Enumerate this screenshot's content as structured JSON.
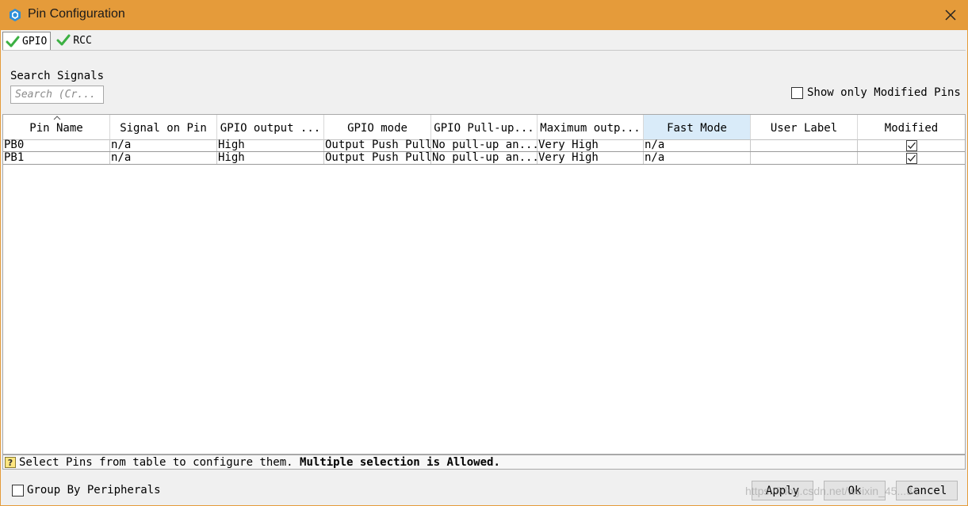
{
  "window": {
    "title": "Pin Configuration"
  },
  "tabs": [
    {
      "label": "GPIO",
      "active": true
    },
    {
      "label": "RCC",
      "active": false
    }
  ],
  "search": {
    "label": "Search Signals",
    "placeholder": "Search (Cr..."
  },
  "show_modified": {
    "label": "Show only Modified Pins",
    "checked": false
  },
  "table": {
    "columns": [
      "Pin Name",
      "Signal on Pin",
      "GPIO output ...",
      "GPIO mode",
      "GPIO Pull-up...",
      "Maximum outp...",
      "Fast Mode",
      "User Label",
      "Modified"
    ],
    "sorted_column": "Pin Name",
    "highlighted_column": "Fast Mode",
    "rows": [
      {
        "pin": "PB0",
        "signal": "n/a",
        "output": "High",
        "mode": "Output Push Pull",
        "pull": "No pull-up an...",
        "speed": "Very High",
        "fast": "n/a",
        "label": "",
        "modified": true
      },
      {
        "pin": "PB1",
        "signal": "n/a",
        "output": "High",
        "mode": "Output Push Pull",
        "pull": "No pull-up an...",
        "speed": "Very High",
        "fast": "n/a",
        "label": "",
        "modified": true
      }
    ]
  },
  "status": {
    "text": "Select Pins from table to configure them. ",
    "bold_text": "Multiple selection is Allowed."
  },
  "group_by": {
    "label": "Group By Peripherals",
    "checked": false
  },
  "buttons": {
    "apply": "Apply",
    "ok": "Ok",
    "cancel": "Cancel"
  },
  "watermark": "https://blog.csdn.net/weixin_45...34",
  "colors": {
    "titlebar": "#e59b3a",
    "highlight_header": "#d9ebf9",
    "check_green": "#3cb043"
  },
  "icons": {
    "app": "cube-icon",
    "close": "close-icon",
    "tab_check": "green-check-icon",
    "status": "question-icon"
  }
}
